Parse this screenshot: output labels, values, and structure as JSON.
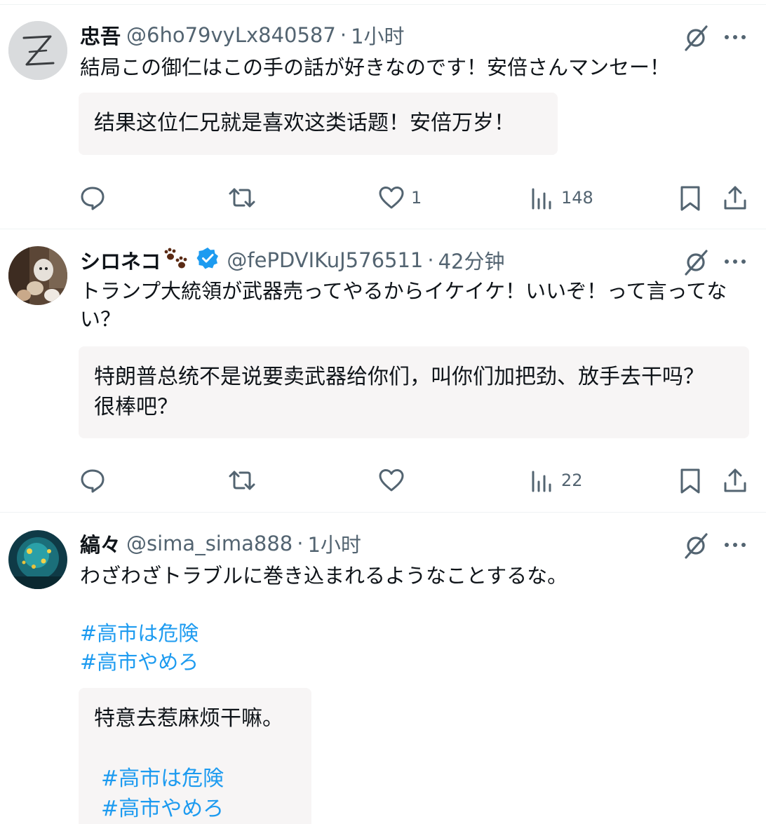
{
  "posts": [
    {
      "name": "忠吾",
      "handle": "@6ho79vyLx840587",
      "separator": "·",
      "time": "1小时",
      "text": "結局この御仁はこの手の話が好きなのです！安倍さんマンセー！",
      "translation": "结果这位仁兄就是喜欢这类话题！安倍万岁！",
      "likes": "1",
      "views": "148",
      "avatar_letter": "Z"
    },
    {
      "name": "シロネコ",
      "handle": "@fePDVIKuJ576511",
      "separator": "·",
      "time": "42分钟",
      "text": "トランプ大統領が武器売ってやるからイケイケ！いいぞ！って言ってない？",
      "translation": "特朗普总统不是说要卖武器给你们，叫你们加把劲、放手去干吗？很棒吧？",
      "likes": "",
      "views": "22",
      "verified": true,
      "name_emoji": "paw-prints-icon"
    },
    {
      "name": "縞々",
      "handle": "@sima_sima888",
      "separator": "·",
      "time": "1小时",
      "text": "わざわざトラブルに巻き込まれるようなことするな。",
      "hashtags": [
        "#高市は危険",
        "#高市やめろ"
      ],
      "translation": "特意去惹麻烦干嘛。",
      "translation_hashtags": [
        "#高市は危険",
        "#高市やめろ"
      ]
    }
  ],
  "colors": {
    "text": "#0f1419",
    "secondary": "#536471",
    "link": "#1d9bf0",
    "verified": "#1d9bf0",
    "translation_bg": "#f7f5f5",
    "divider": "#eff3f4"
  },
  "icons": {
    "reply": "reply-icon",
    "repost": "repost-icon",
    "like": "heart-icon",
    "views": "views-icon",
    "bookmark": "bookmark-icon",
    "share": "share-icon",
    "grok": "grok-icon",
    "more": "more-icon"
  }
}
